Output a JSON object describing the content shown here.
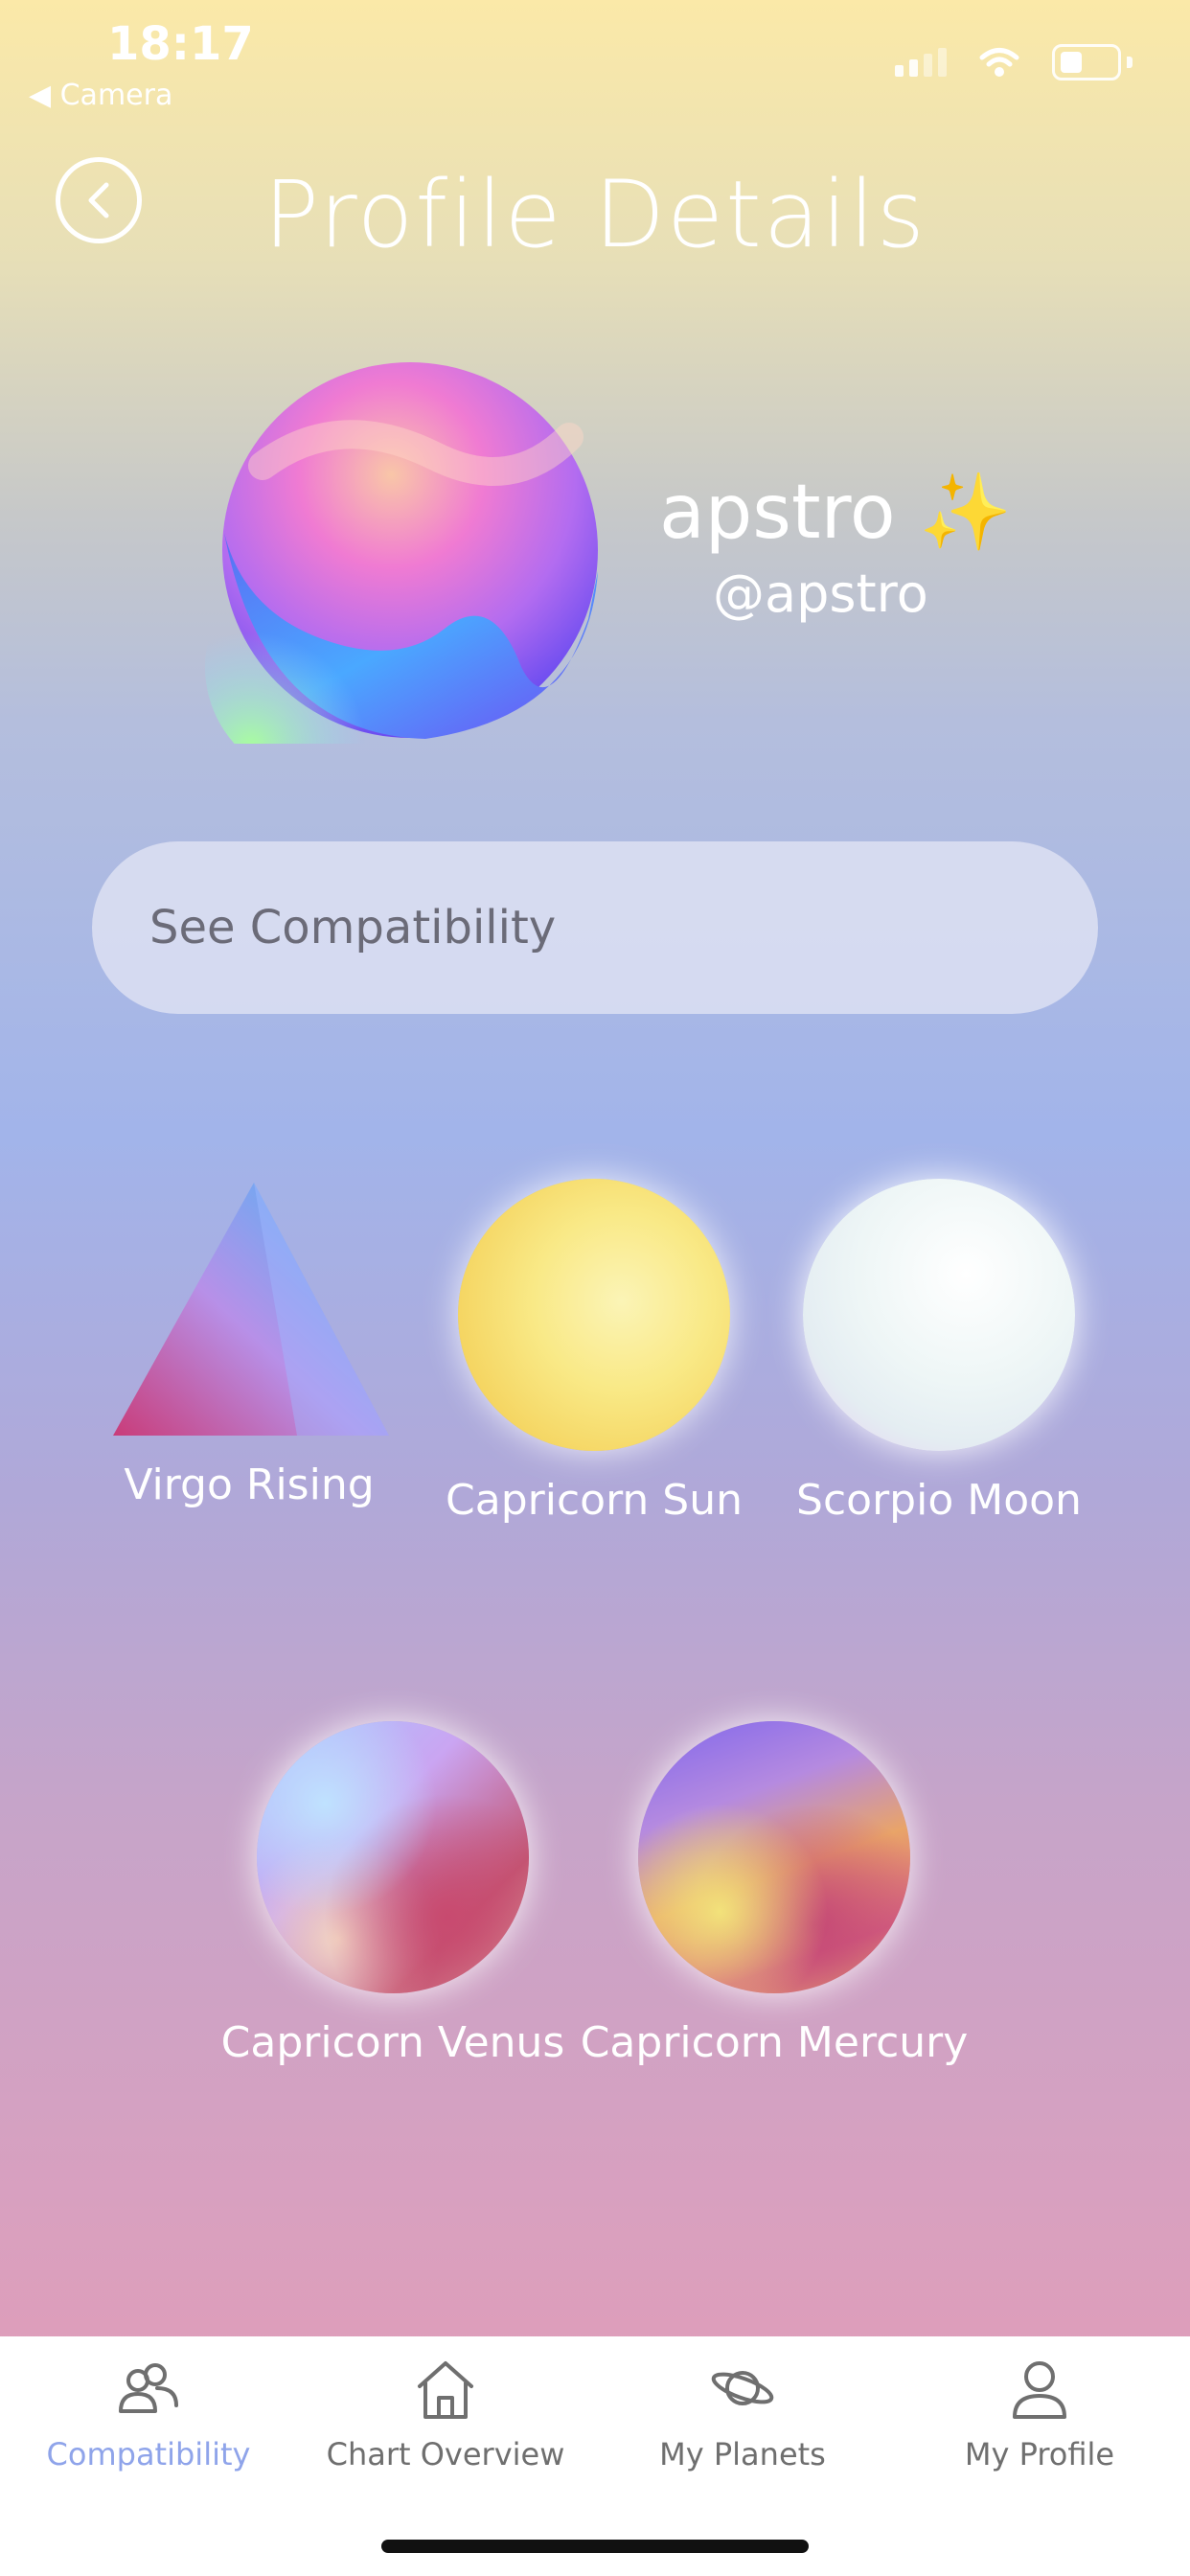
{
  "status": {
    "time": "18:17",
    "back_app": "◀ Camera"
  },
  "header": {
    "title": "Profile Details"
  },
  "profile": {
    "display_name": "apstro ✨",
    "handle": "@apstro"
  },
  "actions": {
    "see_compatibility": "See Compatibility"
  },
  "placements": [
    {
      "label": "Virgo Rising",
      "shape": "triangle"
    },
    {
      "label": "Capricorn Sun",
      "shape": "circle"
    },
    {
      "label": "Scorpio Moon",
      "shape": "circle"
    },
    {
      "label": "Capricorn Venus",
      "shape": "circle"
    },
    {
      "label": "Capricorn Mercury",
      "shape": "circle"
    }
  ],
  "tabs": [
    {
      "label": "Compatibility",
      "icon": "users-icon",
      "active": true
    },
    {
      "label": "Chart Overview",
      "icon": "home-icon",
      "active": false
    },
    {
      "label": "My Planets",
      "icon": "planet-icon",
      "active": false
    },
    {
      "label": "My Profile",
      "icon": "user-icon",
      "active": false
    }
  ],
  "colors": {
    "active_tab": "#8fa4ea",
    "inactive_tab": "#6f6f6f"
  }
}
